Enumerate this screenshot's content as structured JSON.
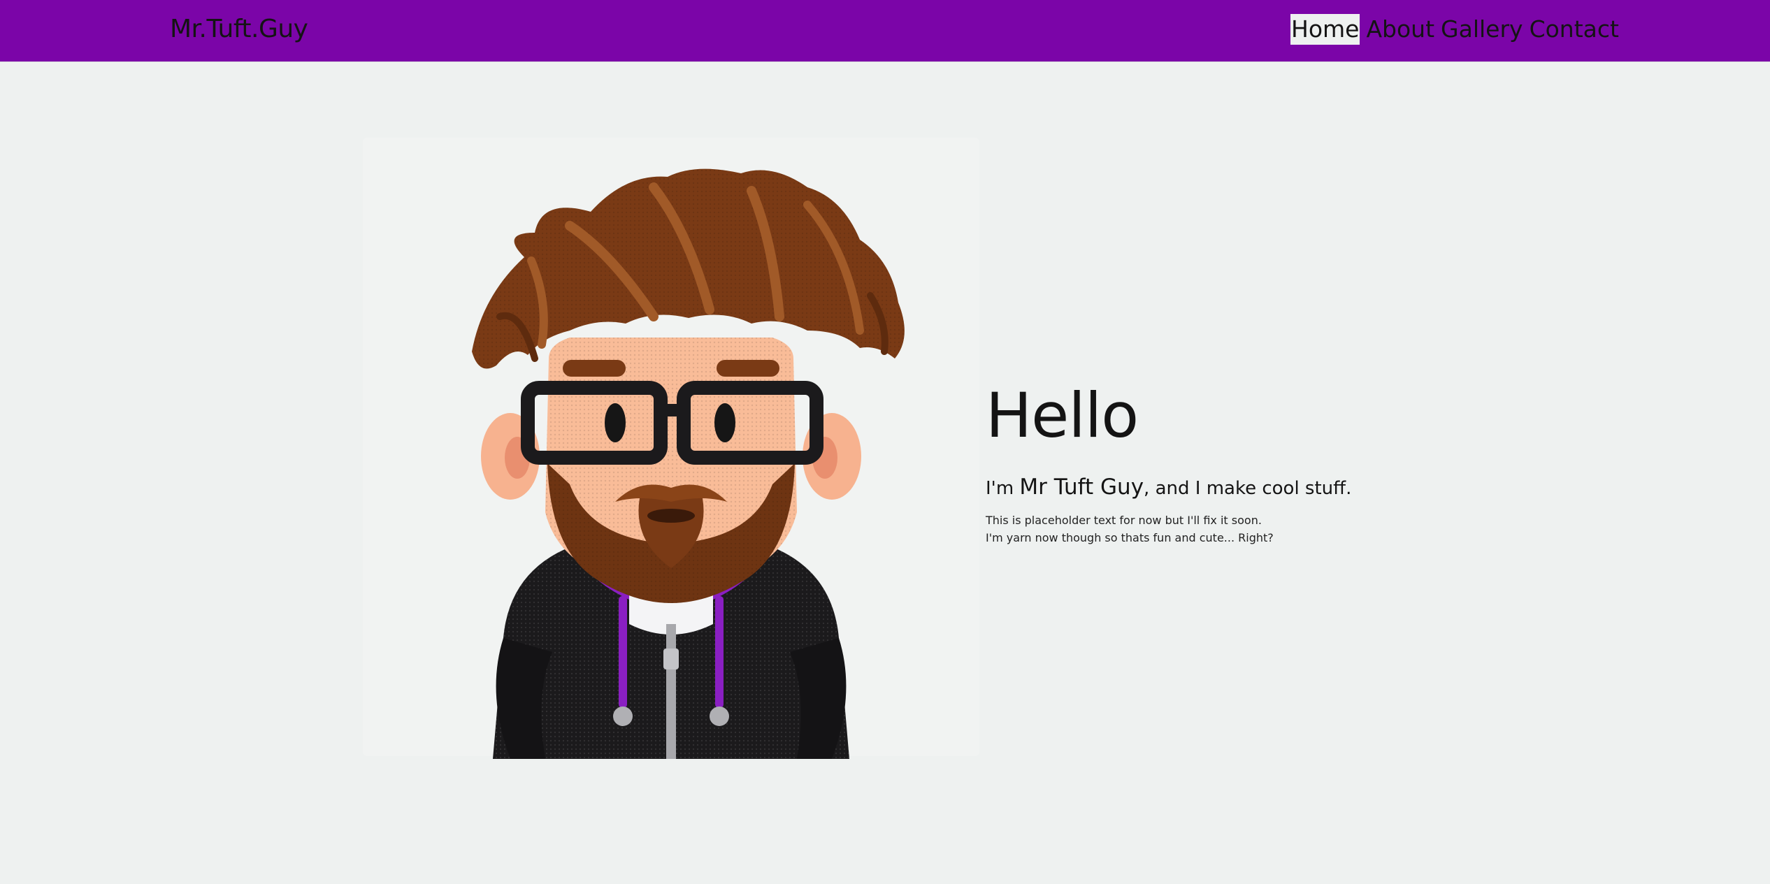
{
  "navbar": {
    "brand": "Mr.Tuft.Guy",
    "links": [
      "Home",
      "About",
      "Gallery",
      "Contact"
    ],
    "active": "Home"
  },
  "hero": {
    "greeting": "Hello",
    "intro_prefix": "I'm",
    "intro_name": "Mr Tuft Guy",
    "intro_suffix": ", and I make cool stuff.",
    "desc_line1": "This is placeholder text for now but I'll fix it soon.",
    "desc_line2": "I'm yarn now though so thats fun and cute... Right?"
  },
  "colors": {
    "navbar": "#7b05a8",
    "background": "#eef1f0",
    "hoodie_accent": "#8a1fc2"
  },
  "image": {
    "subject": "yarn-tufted cartoon avatar with brown spiky hair, black glasses, beard and black hoodie with purple accents"
  }
}
